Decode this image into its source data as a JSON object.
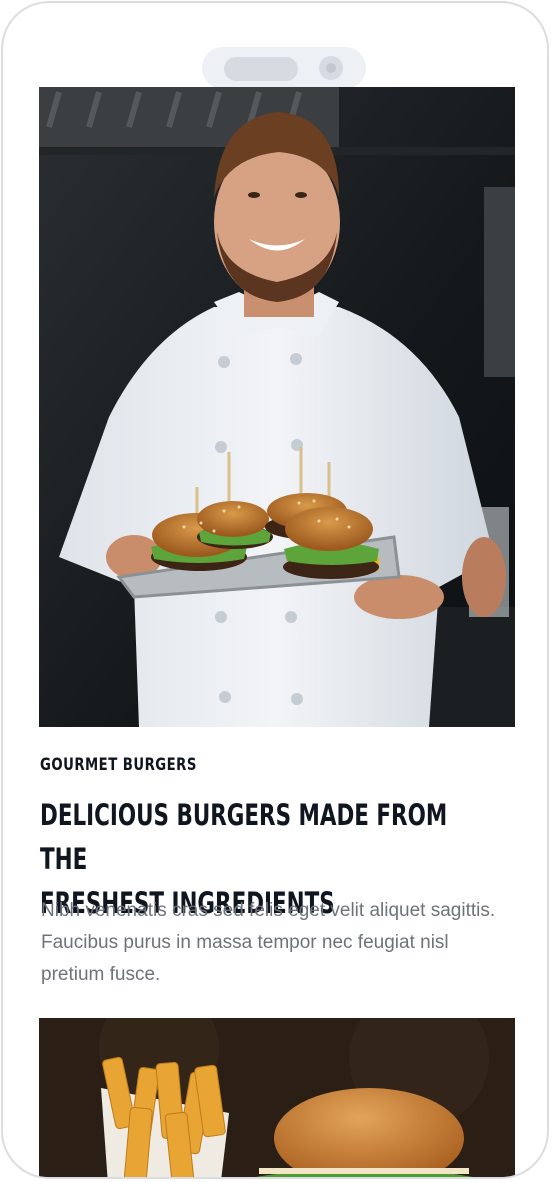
{
  "article": {
    "kicker": "GOURMET BURGERS",
    "headline_line1": "DELICIOUS BURGERS MADE FROM THE",
    "headline_line2": "FRESHEST INGREDIENTS",
    "body": "Nibh venenatis cras sed felis eget velit aliquet sagittis. Faucibus purus in massa tempor nec feugiat nisl pretium fusce."
  },
  "images": {
    "hero": "chef-holding-burger-tray-photo",
    "secondary": "fries-and-burger-photo"
  },
  "colors": {
    "heading": "#10161f",
    "body": "#6e737b",
    "frame": "#dcdde1"
  }
}
